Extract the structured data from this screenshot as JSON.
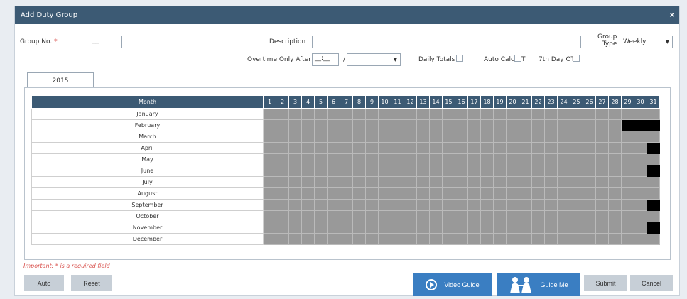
{
  "dialog": {
    "title": "Add Duty Group",
    "close_label": "×"
  },
  "form": {
    "group_no_label": "Group No.",
    "required_mark": "*",
    "group_no_value": "__",
    "description_label": "Description",
    "description_value": "",
    "group_type_label_line1": "Group",
    "group_type_label_line2": "Type",
    "group_type_value": "Weekly",
    "overtime_label": "Overtime Only After",
    "overtime_value": "__:__",
    "overtime_separator": "/",
    "overtime_unit_value": "",
    "daily_totals_label": "Daily Totals",
    "auto_calc_ot_label": "Auto Calc OT",
    "seventh_day_ot_label": "7th Day OT"
  },
  "tabs": [
    {
      "label": "2015"
    }
  ],
  "calendar": {
    "month_header": "Month",
    "days": [
      "1",
      "2",
      "3",
      "4",
      "5",
      "6",
      "7",
      "8",
      "9",
      "10",
      "11",
      "12",
      "13",
      "14",
      "15",
      "16",
      "17",
      "18",
      "19",
      "20",
      "21",
      "22",
      "23",
      "24",
      "25",
      "26",
      "27",
      "28",
      "29",
      "30",
      "31"
    ],
    "months": [
      {
        "name": "January",
        "invalid_days": []
      },
      {
        "name": "February",
        "invalid_days": [
          29,
          30,
          31
        ]
      },
      {
        "name": "March",
        "invalid_days": []
      },
      {
        "name": "April",
        "invalid_days": [
          31
        ]
      },
      {
        "name": "May",
        "invalid_days": []
      },
      {
        "name": "June",
        "invalid_days": [
          31
        ]
      },
      {
        "name": "July",
        "invalid_days": []
      },
      {
        "name": "August",
        "invalid_days": []
      },
      {
        "name": "September",
        "invalid_days": [
          31
        ]
      },
      {
        "name": "October",
        "invalid_days": []
      },
      {
        "name": "November",
        "invalid_days": [
          31
        ]
      },
      {
        "name": "December",
        "invalid_days": []
      }
    ]
  },
  "footer": {
    "important_note": "Important: * is a required field",
    "auto_label": "Auto",
    "reset_label": "Reset",
    "video_guide_label": "Video Guide",
    "guide_me_label": "Guide Me",
    "submit_label": "Submit",
    "cancel_label": "Cancel"
  },
  "colors": {
    "header_bg": "#3c5a74",
    "accent_blue": "#3a7ec2",
    "cell_grey": "#999999",
    "invalid_day": "#000000",
    "required": "#d9534f"
  }
}
